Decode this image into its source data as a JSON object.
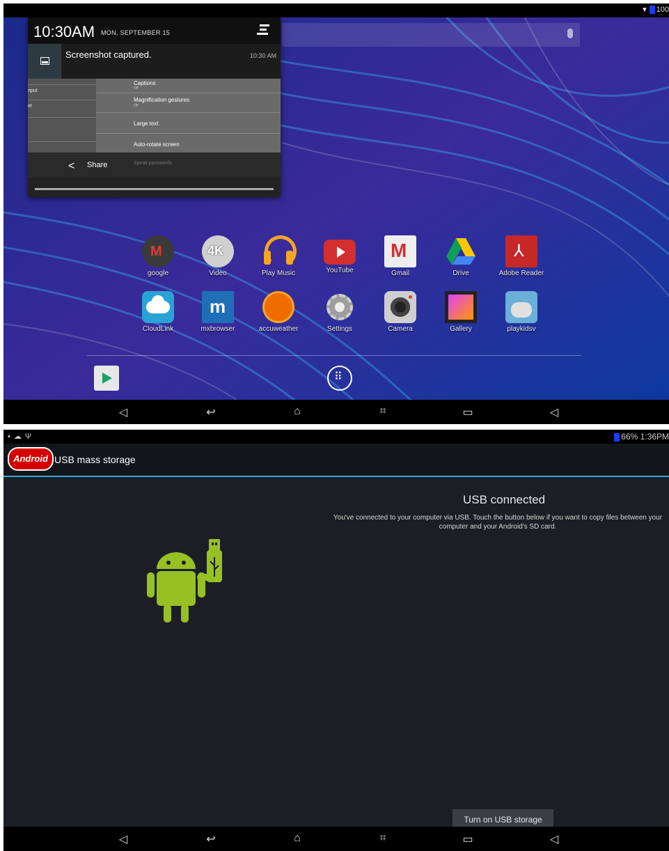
{
  "top_screen": {
    "status_bar": {
      "battery_text": "100"
    },
    "notification": {
      "time": "10:30AM",
      "date": "MON, SEPTEMBER 15",
      "title": "Screenshot captured.",
      "timestamp": "10:30 AM",
      "share_label": "Share",
      "thumbnail": {
        "left_items": [
          "nput",
          "et"
        ],
        "right_items": [
          {
            "title": "Captions",
            "sub": "Off"
          },
          {
            "title": "Magnification gestures",
            "sub": "Off"
          },
          {
            "title": "Large text",
            "sub": ""
          },
          {
            "title": "Auto-rotate screen",
            "sub": ""
          }
        ],
        "faded_item": "Speak passwords"
      }
    },
    "apps_row1": [
      {
        "label": "google",
        "icon": "google-icon",
        "color": "#444444"
      },
      {
        "label": "Video",
        "icon": "video-4k-icon",
        "color": "#bbbbbb"
      },
      {
        "label": "Play Music",
        "icon": "play-music-icon",
        "color": "#f5a623"
      },
      {
        "label": "YouTube",
        "icon": "youtube-icon",
        "color": "#d32f2f"
      },
      {
        "label": "Gmail",
        "icon": "gmail-icon",
        "color": "#eeeeee"
      },
      {
        "label": "Drive",
        "icon": "drive-icon",
        "color": "#2e7d32"
      },
      {
        "label": "Adobe Reader",
        "icon": "adobe-reader-icon",
        "color": "#c62828"
      }
    ],
    "apps_row2": [
      {
        "label": "CloudLink",
        "icon": "cloudlink-icon",
        "color": "#29a3d6"
      },
      {
        "label": "mxbrowser",
        "icon": "mxbrowser-icon",
        "color": "#1e6fb8"
      },
      {
        "label": "accuweather",
        "icon": "accuweather-icon",
        "color": "#ef6c00"
      },
      {
        "label": "Settings",
        "icon": "settings-gear-icon",
        "color": "#9e9e9e"
      },
      {
        "label": "Camera",
        "icon": "camera-icon",
        "color": "#cfcfcf"
      },
      {
        "label": "Gallery",
        "icon": "gallery-icon",
        "color": "#8e3a8e"
      },
      {
        "label": "playkidsv",
        "icon": "playkidsv-icon",
        "color": "#6ab0d8"
      }
    ]
  },
  "bottom_screen": {
    "status_bar": {
      "battery_time": "66% 1:36PM"
    },
    "action_bar": {
      "logo_text": "Android",
      "title": "USB mass storage"
    },
    "heading": "USB connected",
    "description": "You've connected to your computer via USB. Touch the button below if you want to copy files between your computer and your Android's SD card.",
    "button_label": "Turn on USB storage"
  },
  "navigation": {
    "buttons": [
      "volume-down-icon",
      "back-icon",
      "home-icon",
      "screenshot-icon",
      "recents-icon",
      "volume-up-icon"
    ]
  }
}
